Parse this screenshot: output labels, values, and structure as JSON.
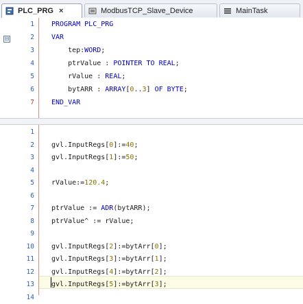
{
  "tabs": [
    {
      "label": "PLC_PRG",
      "close": "×",
      "icon": "program-icon",
      "active": true
    },
    {
      "label": "ModbusTCP_Slave_Device",
      "icon": "device-icon",
      "active": false
    },
    {
      "label": "MainTask",
      "icon": "task-icon",
      "active": false
    }
  ],
  "declaration": {
    "fold_glyph": "⊟",
    "lines": [
      {
        "n": "1",
        "text": "PROGRAM PLC_PRG"
      },
      {
        "n": "2",
        "text": "VAR"
      },
      {
        "n": "3",
        "text": "    tep:WORD;"
      },
      {
        "n": "4",
        "text": "    ptrValue : POINTER TO REAL;"
      },
      {
        "n": "5",
        "text": "    rValue : REAL;"
      },
      {
        "n": "6",
        "text": "    bytARR : ARRAY[0..3] OF BYTE;"
      },
      {
        "n": "7",
        "text": "END_VAR"
      }
    ]
  },
  "implementation": {
    "lines": [
      {
        "n": "1",
        "text": ""
      },
      {
        "n": "2",
        "text": "gvl.InputRegs[0]:=40;"
      },
      {
        "n": "3",
        "text": "gvl.InputRegs[1]:=50;"
      },
      {
        "n": "4",
        "text": ""
      },
      {
        "n": "5",
        "text": "rValue:=120.4;"
      },
      {
        "n": "6",
        "text": ""
      },
      {
        "n": "7",
        "text": "ptrValue := ADR(bytARR);"
      },
      {
        "n": "8",
        "text": "ptrValue^ := rValue;"
      },
      {
        "n": "9",
        "text": ""
      },
      {
        "n": "10",
        "text": "gvl.InputRegs[2]:=bytArr[0];"
      },
      {
        "n": "11",
        "text": "gvl.InputRegs[3]:=bytArr[1];"
      },
      {
        "n": "12",
        "text": "gvl.InputRegs[4]:=bytArr[2];"
      },
      {
        "n": "13",
        "text": "gvl.InputRegs[5]:=bytArr[3];"
      },
      {
        "n": "14",
        "text": ""
      }
    ]
  },
  "colors": {
    "keyword": "#0000c0",
    "number": "#8a6f00",
    "line_number": "#2a5db0"
  }
}
